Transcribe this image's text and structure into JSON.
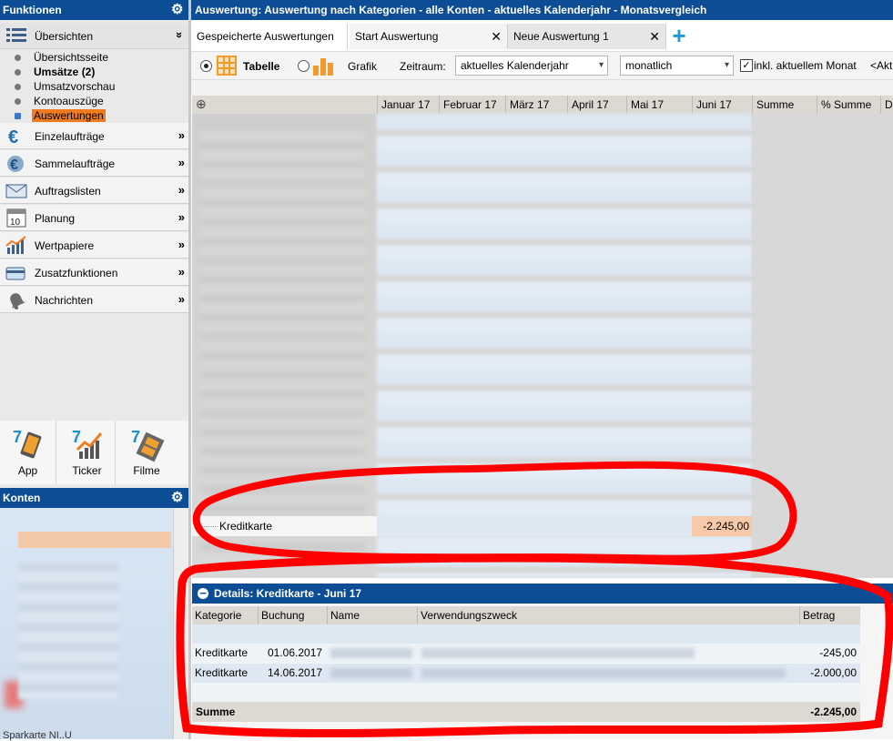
{
  "sidebar": {
    "title": "Funktionen",
    "overview": {
      "label": "Übersichten",
      "chevron": "»"
    },
    "subitems": [
      {
        "label": "Übersichtsseite",
        "bold": false
      },
      {
        "label": "Umsätze (2)",
        "bold": true
      },
      {
        "label": "Umsatzvorschau",
        "bold": false
      },
      {
        "label": "Kontoauszüge",
        "bold": false
      },
      {
        "label": "Auswertungen",
        "bold": false,
        "selected": true
      }
    ],
    "items": [
      {
        "label": "Einzelaufträge",
        "icon": "euro-icon"
      },
      {
        "label": "Sammelaufträge",
        "icon": "euro-stack-icon"
      },
      {
        "label": "Auftragslisten",
        "icon": "envelope-icon"
      },
      {
        "label": "Planung",
        "icon": "calendar-icon"
      },
      {
        "label": "Wertpapiere",
        "icon": "stock-chart-icon"
      },
      {
        "label": "Zusatzfunktionen",
        "icon": "card-icon"
      },
      {
        "label": "Nachrichten",
        "icon": "bell-icon"
      }
    ],
    "chevron": "»",
    "calendar_day": "10",
    "tiles": [
      {
        "label": "App",
        "icon": "app-icon"
      },
      {
        "label": "Ticker",
        "icon": "ticker-icon"
      },
      {
        "label": "Filme",
        "icon": "film-icon"
      }
    ],
    "tile_badge": "7",
    "accounts_title": "Konten",
    "accounts_bottom": "Sparkarte NI..U"
  },
  "window": {
    "title": "Auswertung: Auswertung nach Kategorien - alle Konten - aktuelles Kalenderjahr - Monatsvergleich"
  },
  "tabs": [
    {
      "label": "Gespeicherte Auswertungen",
      "closable": false
    },
    {
      "label": "Start Auswertung",
      "closable": true
    },
    {
      "label": "Neue Auswertung 1",
      "closable": true
    }
  ],
  "tab_close": "✕",
  "add_tab": "+",
  "toolbar": {
    "table_label": "Tabelle",
    "chart_label": "Grafik",
    "period_label": "Zeitraum:",
    "period_value": "aktuelles Kalenderjahr",
    "interval_value": "monatlich",
    "include_current_label": "inkl. aktuellem Monat",
    "include_current_checked": true,
    "overflow_text": "<Aktu"
  },
  "grid": {
    "columns": [
      "Januar 17",
      "Februar 17",
      "März 17",
      "April 17",
      "Mai 17",
      "Juni 17",
      "Summe",
      "% Summe",
      "D"
    ],
    "expand_all": "⊕",
    "highlight_row": {
      "label": "Kreditkarte",
      "june_value": "-2.245,00"
    }
  },
  "details": {
    "title": "Details: Kreditkarte - Juni 17",
    "collapse": "−",
    "columns": [
      "Kategorie",
      "Buchung",
      "Name",
      "Verwendungszweck",
      "Betrag"
    ],
    "rows": [
      {
        "kategorie": "Kreditkarte",
        "buchung": "01.06.2017",
        "betrag": "-245,00"
      },
      {
        "kategorie": "Kreditkarte",
        "buchung": "14.06.2017",
        "betrag": "-2.000,00"
      }
    ],
    "sum_label": "Summe",
    "sum_value": "-2.245,00"
  },
  "colors": {
    "header_blue": "#0c4d95",
    "selected_orange": "#f07b1e",
    "highlight_peach": "#f7c9a9",
    "annotation_red": "#ff0000",
    "plus_cyan": "#1d9bd8"
  }
}
